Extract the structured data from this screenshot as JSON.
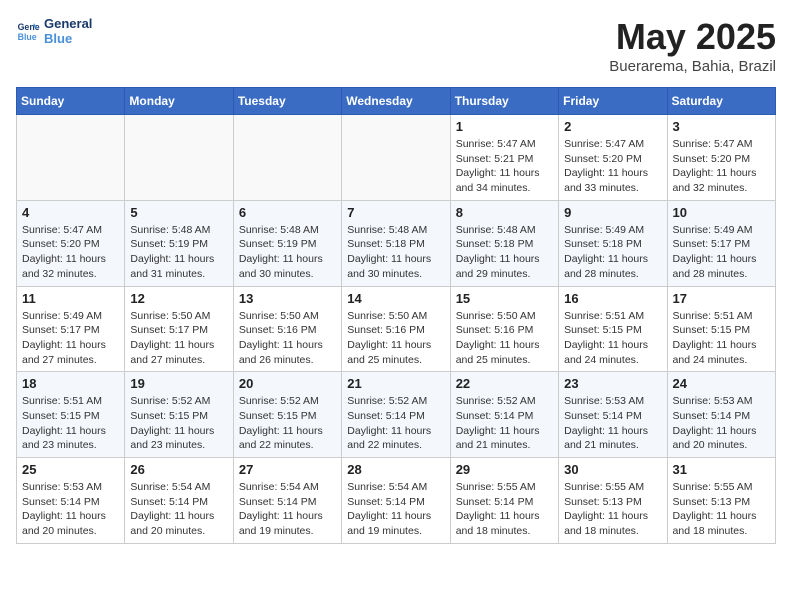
{
  "logo": {
    "line1": "General",
    "line2": "Blue"
  },
  "title": "May 2025",
  "location": "Buerarema, Bahia, Brazil",
  "weekdays": [
    "Sunday",
    "Monday",
    "Tuesday",
    "Wednesday",
    "Thursday",
    "Friday",
    "Saturday"
  ],
  "weeks": [
    [
      {
        "day": "",
        "info": ""
      },
      {
        "day": "",
        "info": ""
      },
      {
        "day": "",
        "info": ""
      },
      {
        "day": "",
        "info": ""
      },
      {
        "day": "1",
        "info": "Sunrise: 5:47 AM\nSunset: 5:21 PM\nDaylight: 11 hours\nand 34 minutes."
      },
      {
        "day": "2",
        "info": "Sunrise: 5:47 AM\nSunset: 5:20 PM\nDaylight: 11 hours\nand 33 minutes."
      },
      {
        "day": "3",
        "info": "Sunrise: 5:47 AM\nSunset: 5:20 PM\nDaylight: 11 hours\nand 32 minutes."
      }
    ],
    [
      {
        "day": "4",
        "info": "Sunrise: 5:47 AM\nSunset: 5:20 PM\nDaylight: 11 hours\nand 32 minutes."
      },
      {
        "day": "5",
        "info": "Sunrise: 5:48 AM\nSunset: 5:19 PM\nDaylight: 11 hours\nand 31 minutes."
      },
      {
        "day": "6",
        "info": "Sunrise: 5:48 AM\nSunset: 5:19 PM\nDaylight: 11 hours\nand 30 minutes."
      },
      {
        "day": "7",
        "info": "Sunrise: 5:48 AM\nSunset: 5:18 PM\nDaylight: 11 hours\nand 30 minutes."
      },
      {
        "day": "8",
        "info": "Sunrise: 5:48 AM\nSunset: 5:18 PM\nDaylight: 11 hours\nand 29 minutes."
      },
      {
        "day": "9",
        "info": "Sunrise: 5:49 AM\nSunset: 5:18 PM\nDaylight: 11 hours\nand 28 minutes."
      },
      {
        "day": "10",
        "info": "Sunrise: 5:49 AM\nSunset: 5:17 PM\nDaylight: 11 hours\nand 28 minutes."
      }
    ],
    [
      {
        "day": "11",
        "info": "Sunrise: 5:49 AM\nSunset: 5:17 PM\nDaylight: 11 hours\nand 27 minutes."
      },
      {
        "day": "12",
        "info": "Sunrise: 5:50 AM\nSunset: 5:17 PM\nDaylight: 11 hours\nand 27 minutes."
      },
      {
        "day": "13",
        "info": "Sunrise: 5:50 AM\nSunset: 5:16 PM\nDaylight: 11 hours\nand 26 minutes."
      },
      {
        "day": "14",
        "info": "Sunrise: 5:50 AM\nSunset: 5:16 PM\nDaylight: 11 hours\nand 25 minutes."
      },
      {
        "day": "15",
        "info": "Sunrise: 5:50 AM\nSunset: 5:16 PM\nDaylight: 11 hours\nand 25 minutes."
      },
      {
        "day": "16",
        "info": "Sunrise: 5:51 AM\nSunset: 5:15 PM\nDaylight: 11 hours\nand 24 minutes."
      },
      {
        "day": "17",
        "info": "Sunrise: 5:51 AM\nSunset: 5:15 PM\nDaylight: 11 hours\nand 24 minutes."
      }
    ],
    [
      {
        "day": "18",
        "info": "Sunrise: 5:51 AM\nSunset: 5:15 PM\nDaylight: 11 hours\nand 23 minutes."
      },
      {
        "day": "19",
        "info": "Sunrise: 5:52 AM\nSunset: 5:15 PM\nDaylight: 11 hours\nand 23 minutes."
      },
      {
        "day": "20",
        "info": "Sunrise: 5:52 AM\nSunset: 5:15 PM\nDaylight: 11 hours\nand 22 minutes."
      },
      {
        "day": "21",
        "info": "Sunrise: 5:52 AM\nSunset: 5:14 PM\nDaylight: 11 hours\nand 22 minutes."
      },
      {
        "day": "22",
        "info": "Sunrise: 5:52 AM\nSunset: 5:14 PM\nDaylight: 11 hours\nand 21 minutes."
      },
      {
        "day": "23",
        "info": "Sunrise: 5:53 AM\nSunset: 5:14 PM\nDaylight: 11 hours\nand 21 minutes."
      },
      {
        "day": "24",
        "info": "Sunrise: 5:53 AM\nSunset: 5:14 PM\nDaylight: 11 hours\nand 20 minutes."
      }
    ],
    [
      {
        "day": "25",
        "info": "Sunrise: 5:53 AM\nSunset: 5:14 PM\nDaylight: 11 hours\nand 20 minutes."
      },
      {
        "day": "26",
        "info": "Sunrise: 5:54 AM\nSunset: 5:14 PM\nDaylight: 11 hours\nand 20 minutes."
      },
      {
        "day": "27",
        "info": "Sunrise: 5:54 AM\nSunset: 5:14 PM\nDaylight: 11 hours\nand 19 minutes."
      },
      {
        "day": "28",
        "info": "Sunrise: 5:54 AM\nSunset: 5:14 PM\nDaylight: 11 hours\nand 19 minutes."
      },
      {
        "day": "29",
        "info": "Sunrise: 5:55 AM\nSunset: 5:14 PM\nDaylight: 11 hours\nand 18 minutes."
      },
      {
        "day": "30",
        "info": "Sunrise: 5:55 AM\nSunset: 5:13 PM\nDaylight: 11 hours\nand 18 minutes."
      },
      {
        "day": "31",
        "info": "Sunrise: 5:55 AM\nSunset: 5:13 PM\nDaylight: 11 hours\nand 18 minutes."
      }
    ]
  ]
}
